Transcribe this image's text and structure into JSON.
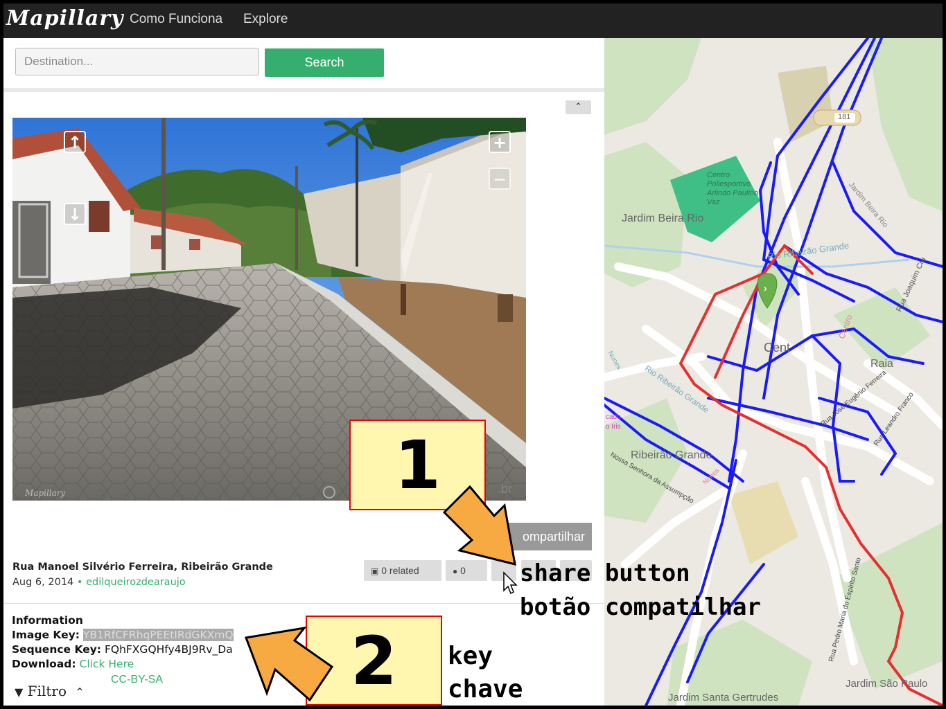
{
  "nav": {
    "logo": "Mapillary",
    "links": [
      "Como Funciona",
      "Explore"
    ]
  },
  "search": {
    "placeholder": "Destination...",
    "button_label": "Search"
  },
  "viewer": {
    "collapse_glyph": "⌃",
    "watermark": "Mapillary",
    "badge": ".br",
    "share_label": "ompartilhar"
  },
  "image_meta": {
    "address": "Rua Manoel Silvério Ferreira, Ribeirão Grande",
    "date": "Aug 6, 2014",
    "separator": "•",
    "user": "edilqueirozdearaujo",
    "related_label": "0 related",
    "comments_count": "0"
  },
  "info": {
    "heading": "Information",
    "image_key_label": "Image Key:",
    "image_key_value": "YB1RfCFRhqPEEtIRdGKXmQ",
    "sequence_key_label": "Sequence Key:",
    "sequence_key_value": "FQhFXGQHfy4BJ9Rv_Da",
    "download_label": "Download:",
    "download_link": "Click Here",
    "license": "CC-BY-SA",
    "filter_label": "Filtro",
    "filter_glyph": "⌃"
  },
  "map": {
    "labels": [
      "Jardim Beira Rio",
      "Centro Poliesportivo Arlindo Paulino Vaz",
      "Rio Ribeirão Grande",
      "Jardim Beira Rio",
      "Rua Joaquim Cru",
      "Cent",
      "Raia",
      "Centro",
      "Rua José Eugênio Ferreira",
      "Rua Leandro Franco",
      "Ribeirão Grande",
      "Rio Ribeirão Grande",
      "Nunes",
      "Rua Pedro Maria do Espírito Santo",
      "Jardim Santa Gertrudes",
      "Jardim São Paulo",
      "181",
      "Nossa Senhora da Assumpção",
      "Nunes",
      "cado",
      "o Iris"
    ],
    "route_color": "#e53030",
    "sequence_color": "#1a1aff",
    "marker_color": "#6ab04c"
  },
  "annotations": {
    "box1": "1",
    "box2": "2",
    "share_text_en": "share button",
    "share_text_pt": "botão compatilhar",
    "key_text_en": "key",
    "key_text_pt": "chave",
    "arrow_color": "#f7a942"
  }
}
